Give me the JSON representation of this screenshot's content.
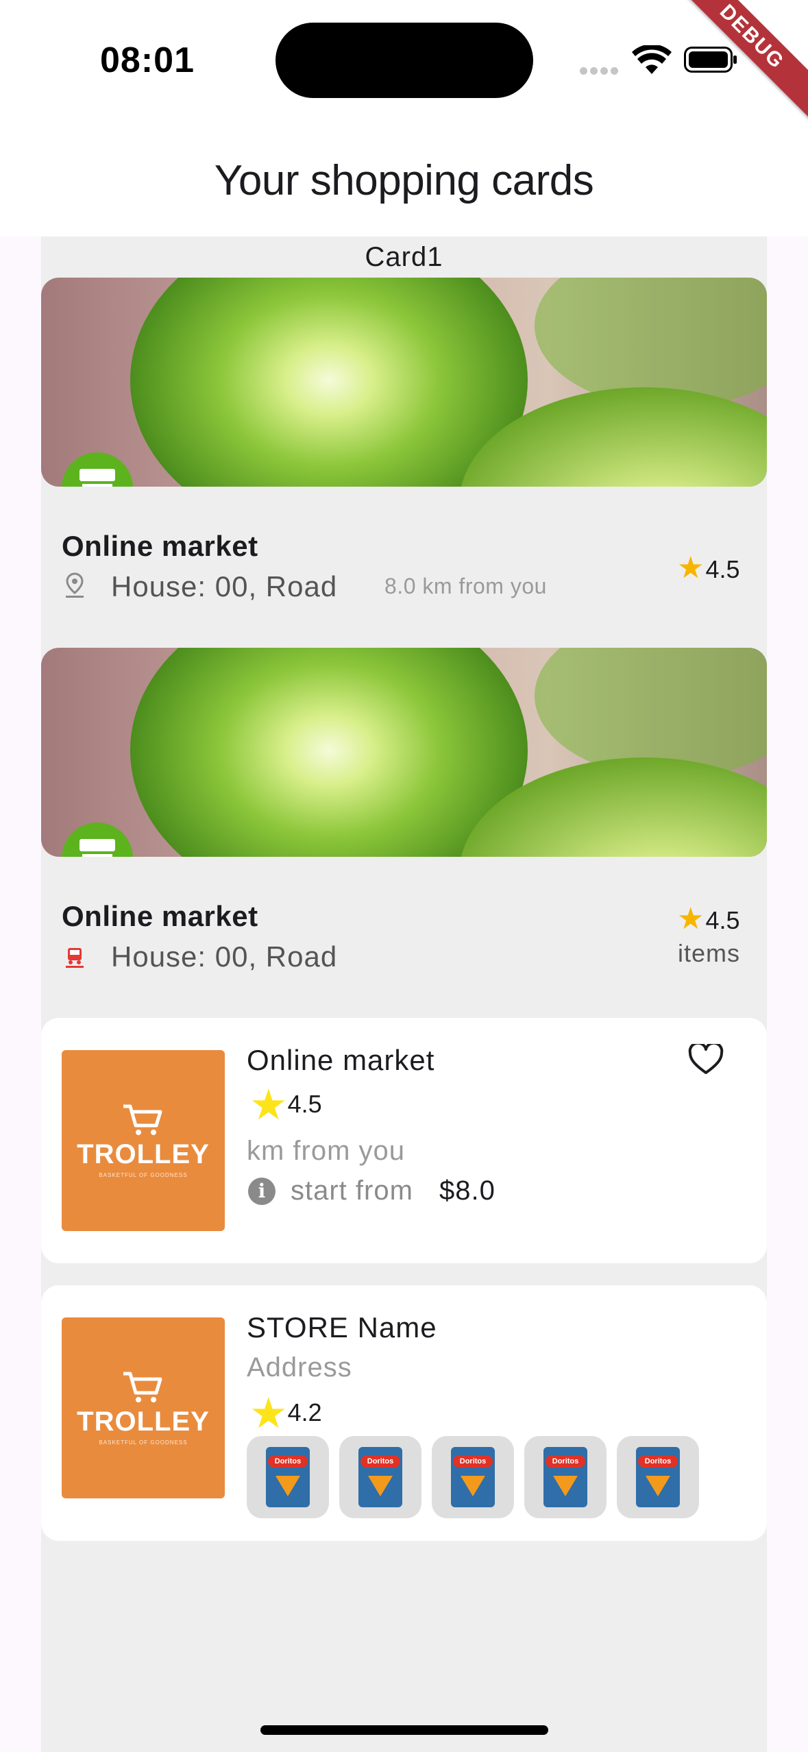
{
  "status_bar": {
    "time": "08:01",
    "debug_label": "DEBUG"
  },
  "app_bar": {
    "title": "Your shopping cards"
  },
  "section": {
    "label": "Card1"
  },
  "cards": [
    {
      "type": "banner-card",
      "title": "Online market",
      "address": "House: 00, Road",
      "distance": "8.0 km from you",
      "rating": "4.5",
      "address_icon": "location-pin-icon"
    },
    {
      "type": "banner-card",
      "title": "Online market",
      "address": "House: 00, Road",
      "rating": "4.5",
      "items_label": "items",
      "address_icon": "delivery-car-icon"
    },
    {
      "type": "store-card",
      "brand": "TROLLEY",
      "tagline": "BASKETFUL OF GOODNESS",
      "name": "Online market",
      "rating": "4.5",
      "distance": "km from you",
      "start_label": "start from",
      "price": "$8.0"
    },
    {
      "type": "store-card-products",
      "brand": "TROLLEY",
      "tagline": "BASKETFUL OF GOODNESS",
      "name": "STORE Name",
      "address": "Address",
      "rating": "4.2",
      "products": [
        {
          "name": "Doritos"
        },
        {
          "name": "Doritos"
        },
        {
          "name": "Doritos"
        },
        {
          "name": "Doritos"
        },
        {
          "name": "Doritos"
        }
      ]
    }
  ],
  "colors": {
    "store_badge": "#5cb31d",
    "rating_star": "#f7b500",
    "thumb_bg": "#e98b3d",
    "content_bg": "#eeeeee"
  }
}
